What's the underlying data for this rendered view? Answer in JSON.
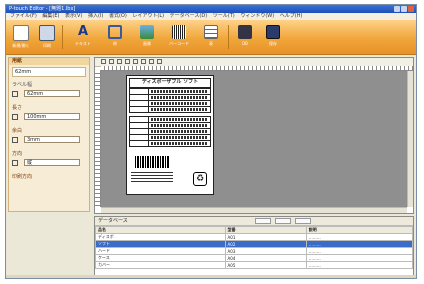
{
  "window": {
    "title": "P-touch Editor - [無題1.lbx]"
  },
  "menu": [
    "ファイル(F)",
    "編集(E)",
    "表示(V)",
    "挿入(I)",
    "書式(O)",
    "レイアウト(L)",
    "データベース(D)",
    "ツール(T)",
    "ウィンドウ(W)",
    "ヘルプ(H)"
  ],
  "toolbar": {
    "buttons": [
      {
        "label": "新規/開く",
        "icon": "new-icon"
      },
      {
        "label": "印刷",
        "icon": "print-icon"
      },
      {
        "label": "テキスト",
        "icon": "text-icon"
      },
      {
        "label": "枠",
        "icon": "frame-icon"
      },
      {
        "label": "画像",
        "icon": "image-icon"
      },
      {
        "label": "バーコード",
        "icon": "barcode-icon"
      },
      {
        "label": "表",
        "icon": "table-icon"
      },
      {
        "label": "DB",
        "icon": "database-icon"
      },
      {
        "label": "保存",
        "icon": "save-icon"
      }
    ]
  },
  "left_panel": {
    "header": "用紙",
    "tape_label": "ラベル幅",
    "tape_value": "62mm",
    "sections": [
      "用紙設定",
      "長さ",
      "余白",
      "方向",
      "印刷方向"
    ],
    "rows": [
      "62mm",
      "100mm",
      "3mm",
      "縦"
    ]
  },
  "label": {
    "title": "ディスポーザブル ソフト",
    "recycle_symbol": "♻"
  },
  "bottom_panel": {
    "title": "データベース",
    "columns": [
      "品名",
      "型番",
      "説明"
    ],
    "rows": [
      [
        "ディスポ",
        "A01",
        "………"
      ],
      [
        "ソフト",
        "A02",
        "………"
      ],
      [
        "ハード",
        "A03",
        "………"
      ],
      [
        "ケース",
        "A04",
        "………"
      ],
      [
        "カバー",
        "A05",
        "………"
      ]
    ],
    "selected_row": 1
  },
  "colors": {
    "toolbar": "#f0a63a",
    "selection": "#3a6cc8"
  }
}
